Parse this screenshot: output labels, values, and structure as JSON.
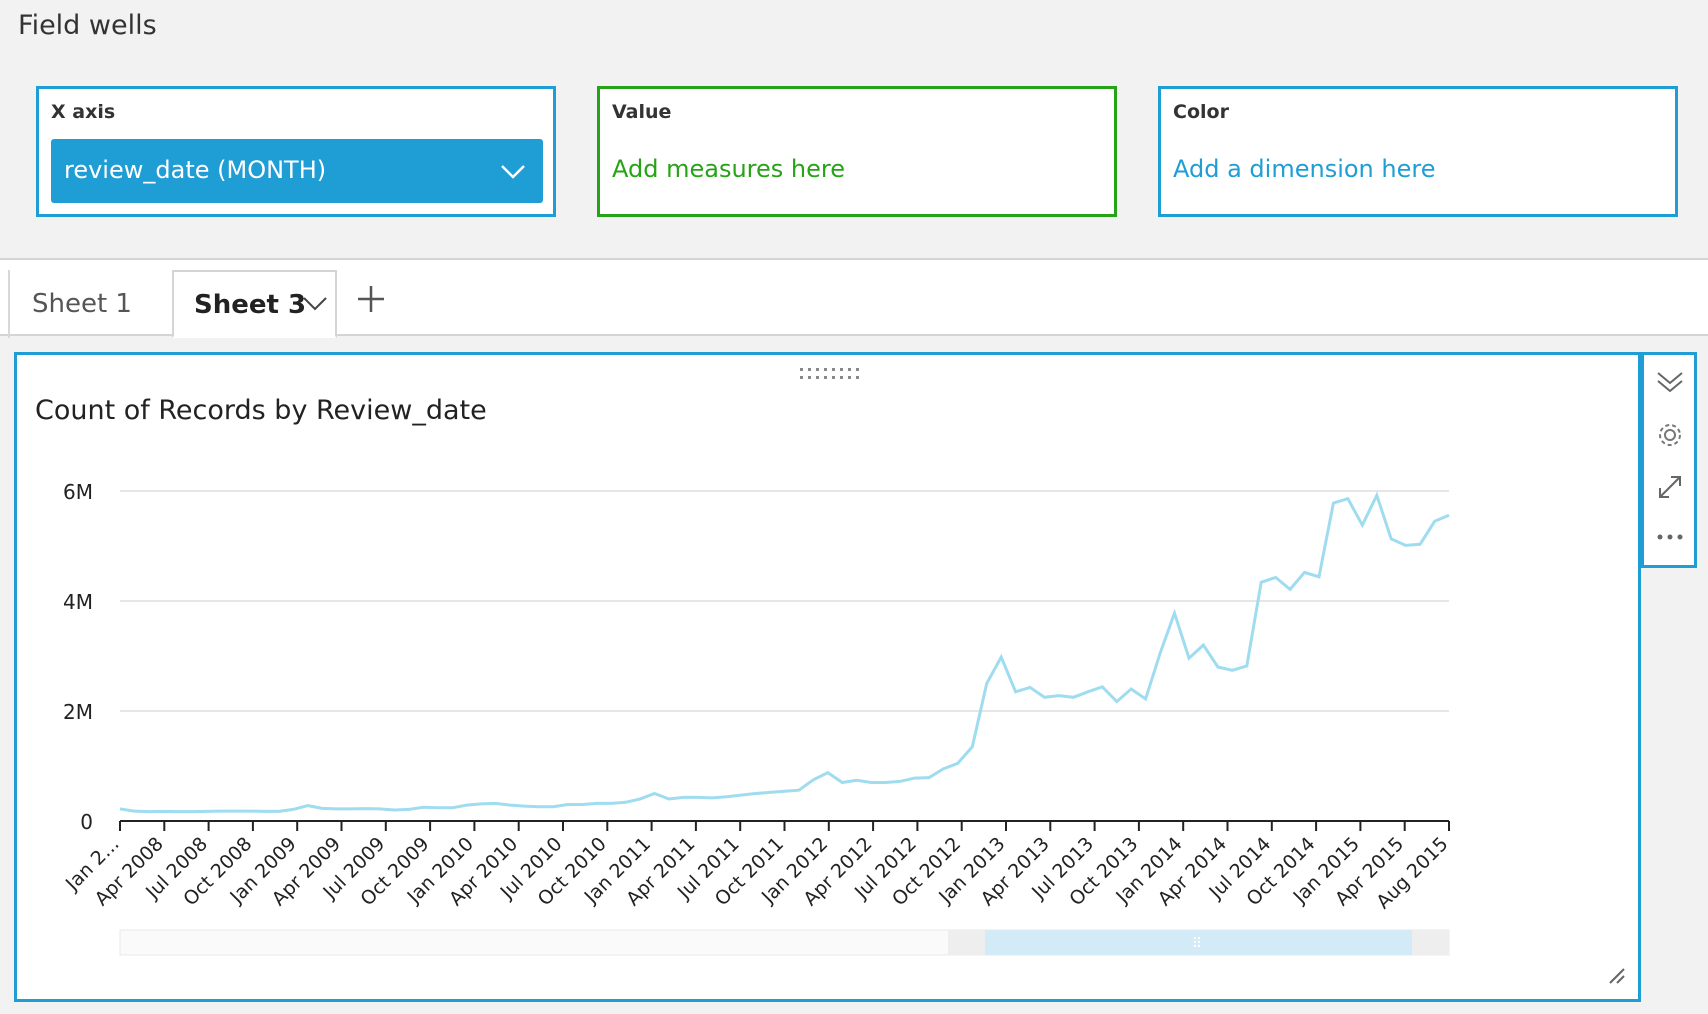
{
  "field_wells": {
    "title": "Field wells",
    "x_axis": {
      "label": "X axis",
      "field": "review_date (MONTH)"
    },
    "value": {
      "label": "Value",
      "placeholder": "Add measures here"
    },
    "color": {
      "label": "Color",
      "placeholder": "Add a dimension here"
    }
  },
  "tabs": [
    {
      "label": "Sheet 1",
      "active": false
    },
    {
      "label": "Sheet 3",
      "active": true
    }
  ],
  "visual": {
    "title": "Count of Records by Review_date",
    "toolbar_icons": [
      "collapse-icon",
      "settings-gear-icon",
      "expand-icon",
      "more-options-icon"
    ]
  },
  "chart_data": {
    "type": "line",
    "title": "Count of Records by Review_date",
    "color": "#9fdcef",
    "y_ticks": [
      "0",
      "2M",
      "4M",
      "6M"
    ],
    "ylim": [
      0,
      6000000
    ],
    "x_tick_labels": [
      "Jan 2...",
      "Apr 2008",
      "Jul 2008",
      "Oct 2008",
      "Jan 2009",
      "Apr 2009",
      "Jul 2009",
      "Oct 2009",
      "Jan 2010",
      "Apr 2010",
      "Jul 2010",
      "Oct 2010",
      "Jan 2011",
      "Apr 2011",
      "Jul 2011",
      "Oct 2011",
      "Jan 2012",
      "Apr 2012",
      "Jul 2012",
      "Oct 2012",
      "Jan 2013",
      "Apr 2013",
      "Jul 2013",
      "Oct 2013",
      "Jan 2014",
      "Apr 2014",
      "Jul 2014",
      "Oct 2014",
      "Jan 2015",
      "Apr 2015",
      "Aug 2015"
    ],
    "start": "Jan 2008",
    "values": [
      220000,
      180000,
      170000,
      175000,
      170000,
      170000,
      175000,
      180000,
      180000,
      180000,
      175000,
      175000,
      210000,
      280000,
      230000,
      220000,
      220000,
      225000,
      220000,
      200000,
      210000,
      250000,
      240000,
      240000,
      290000,
      310000,
      320000,
      290000,
      270000,
      260000,
      260000,
      300000,
      300000,
      320000,
      320000,
      340000,
      400000,
      500000,
      400000,
      430000,
      430000,
      420000,
      440000,
      470000,
      500000,
      520000,
      540000,
      560000,
      750000,
      880000,
      700000,
      740000,
      700000,
      700000,
      720000,
      780000,
      790000,
      950000,
      1050000,
      1350000,
      2500000,
      2980000,
      2350000,
      2430000,
      2250000,
      2280000,
      2250000,
      2350000,
      2440000,
      2170000,
      2400000,
      2220000,
      3050000,
      3780000,
      2960000,
      3200000,
      2800000,
      2740000,
      2820000,
      4340000,
      4430000,
      4210000,
      4520000,
      4440000,
      5780000,
      5860000,
      5380000,
      5920000,
      5130000,
      5010000,
      5030000,
      5450000,
      5560000
    ]
  }
}
